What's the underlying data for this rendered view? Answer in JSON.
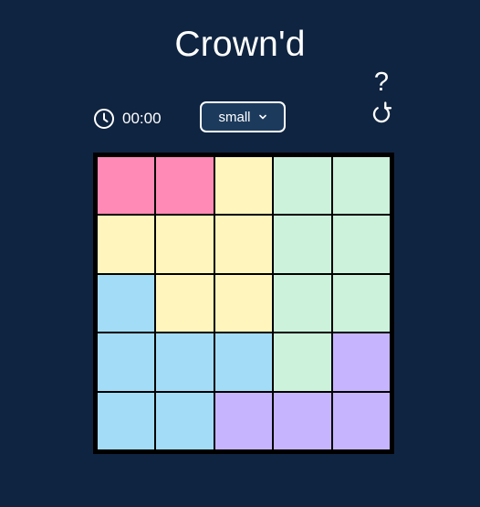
{
  "title": "Crown'd",
  "help_label": "?",
  "timer": {
    "icon": "clock-icon",
    "value": "00:00"
  },
  "size_select": {
    "selected": "small",
    "icon": "chevron-down-icon"
  },
  "reset_icon": "reset-icon",
  "colors": {
    "background": "#0f2440",
    "select_background": "#1c3a5c",
    "pink": "#ff8ab5",
    "yellow": "#fff5bd",
    "green": "#ccf2dc",
    "blue": "#a3dcf7",
    "purple": "#c7b4ff"
  },
  "board": {
    "rows": 5,
    "cols": 5,
    "cells": [
      [
        "pink",
        "pink",
        "yellow",
        "green",
        "green"
      ],
      [
        "yellow",
        "yellow",
        "yellow",
        "green",
        "green"
      ],
      [
        "blue",
        "yellow",
        "yellow",
        "green",
        "green"
      ],
      [
        "blue",
        "blue",
        "blue",
        "green",
        "purple"
      ],
      [
        "blue",
        "blue",
        "purple",
        "purple",
        "purple"
      ]
    ]
  }
}
